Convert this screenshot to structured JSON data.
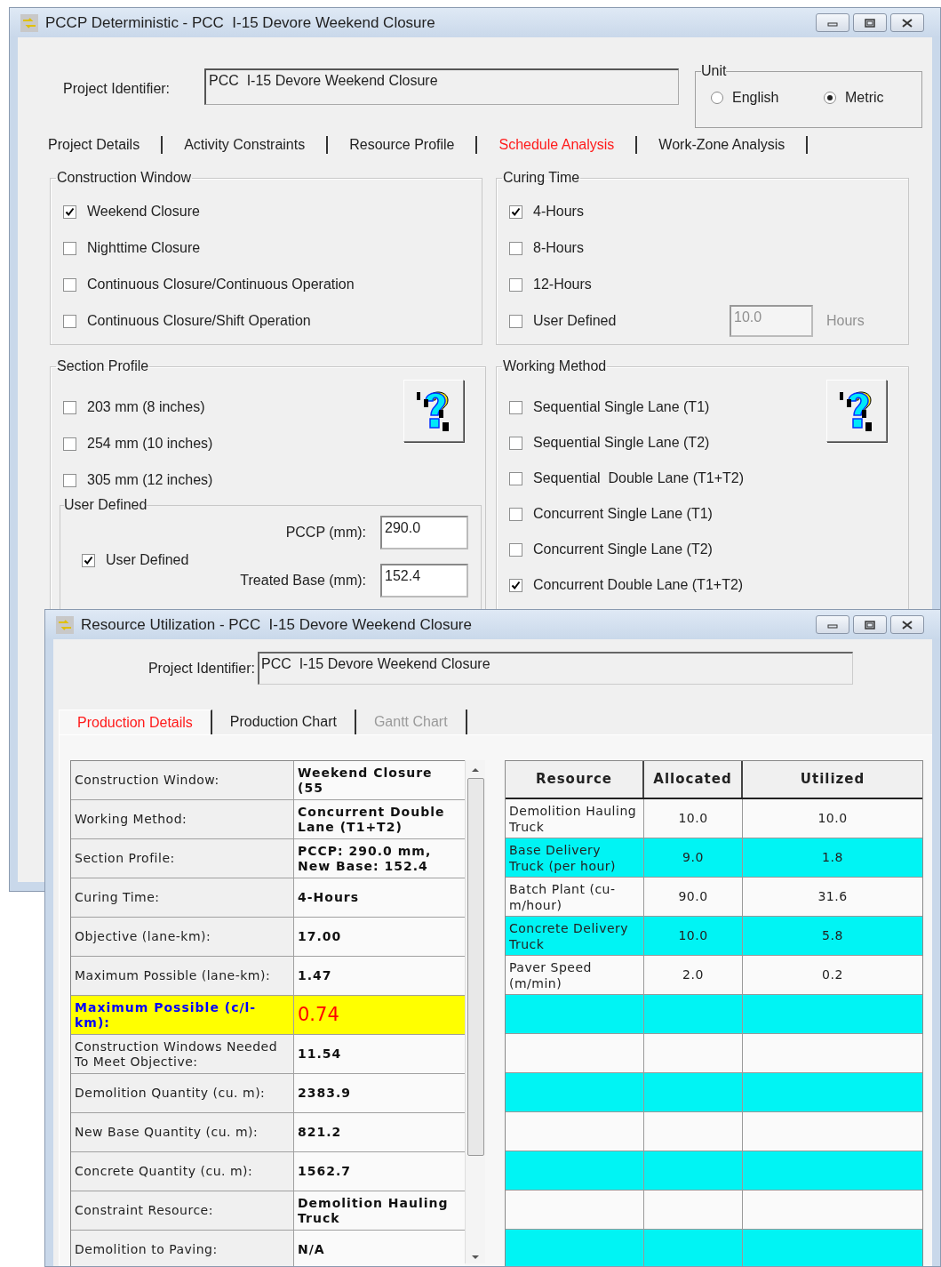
{
  "main_window": {
    "title": "PCCP Deterministic - PCC  I-15 Devore Weekend Closure",
    "project_identifier": {
      "label": "Project Identifier:",
      "value": "PCC  I-15 Devore Weekend Closure"
    },
    "unit": {
      "title": "Unit",
      "options": [
        {
          "label": "English",
          "selected": false
        },
        {
          "label": "Metric",
          "selected": true
        }
      ]
    },
    "tabs": [
      {
        "label": "Project Details",
        "selected": false
      },
      {
        "label": "Activity Constraints",
        "selected": false
      },
      {
        "label": "Resource Profile",
        "selected": false
      },
      {
        "label": "Schedule Analysis",
        "selected": true
      },
      {
        "label": "Work-Zone Analysis",
        "selected": false
      }
    ],
    "construction_window": {
      "title": "Construction Window",
      "options": [
        {
          "label": "Weekend Closure",
          "checked": true
        },
        {
          "label": "Nighttime Closure",
          "checked": false
        },
        {
          "label": "Continuous Closure/Continuous Operation",
          "checked": false
        },
        {
          "label": "Continuous Closure/Shift Operation",
          "checked": false
        }
      ]
    },
    "curing_time": {
      "title": "Curing Time",
      "options": [
        {
          "label": "4-Hours",
          "checked": true
        },
        {
          "label": "8-Hours",
          "checked": false
        },
        {
          "label": "12-Hours",
          "checked": false
        },
        {
          "label": "User Defined",
          "checked": false
        }
      ],
      "user_hours": {
        "value": "10.0",
        "unit": "Hours",
        "disabled": true
      }
    },
    "section_profile": {
      "title": "Section Profile",
      "options": [
        {
          "label": "203 mm (8 inches)",
          "checked": false
        },
        {
          "label": "254 mm (10 inches)",
          "checked": false
        },
        {
          "label": "305 mm (12 inches)",
          "checked": false
        }
      ],
      "user_defined": {
        "title": "User Defined",
        "checkbox": {
          "label": "User Defined",
          "checked": true
        },
        "fields": [
          {
            "label": "PCCP (mm):",
            "value": "290.0"
          },
          {
            "label": "Treated Base (mm):",
            "value": "152.4"
          }
        ]
      }
    },
    "working_method": {
      "title": "Working Method",
      "options": [
        {
          "label": "Sequential Single Lane (T1)",
          "checked": false
        },
        {
          "label": "Sequential Single Lane (T2)",
          "checked": false
        },
        {
          "label": "Sequential  Double Lane (T1+T2)",
          "checked": false
        },
        {
          "label": "Concurrent Single Lane (T1)",
          "checked": false
        },
        {
          "label": "Concurrent Single Lane (T2)",
          "checked": false
        },
        {
          "label": "Concurrent Double Lane (T1+T2)",
          "checked": true
        }
      ]
    }
  },
  "resource_window": {
    "title": "Resource Utilization - PCC  I-15 Devore Weekend Closure",
    "project_identifier": {
      "label": "Project Identifier:",
      "value": "PCC  I-15 Devore Weekend Closure"
    },
    "tabs": [
      {
        "label": "Production Details",
        "selected": true,
        "disabled": false
      },
      {
        "label": "Production Chart",
        "selected": false,
        "disabled": false
      },
      {
        "label": "Gantt Chart",
        "selected": false,
        "disabled": true
      }
    ],
    "details": [
      {
        "label": "Construction Window:",
        "value": "Weekend Closure (55",
        "highlighted": false
      },
      {
        "label": "Working Method:",
        "value": "Concurrent Double Lane (T1+T2)",
        "highlighted": false
      },
      {
        "label": "Section Profile:",
        "value": "PCCP: 290.0 mm, New Base: 152.4",
        "highlighted": false
      },
      {
        "label": "Curing Time:",
        "value": "4-Hours",
        "highlighted": false
      },
      {
        "label": "Objective (lane-km):",
        "value": "17.00",
        "highlighted": false
      },
      {
        "label": "Maximum Possible (lane-km):",
        "value": "1.47",
        "highlighted": false
      },
      {
        "label": "Maximum Possible (c/l-km):",
        "value": "0.74",
        "highlighted": true
      },
      {
        "label": "Construction Windows Needed To Meet Objective:",
        "value": "11.54",
        "highlighted": false
      },
      {
        "label": "Demolition Quantity (cu. m):",
        "value": "2383.9",
        "highlighted": false
      },
      {
        "label": "New Base Quantity (cu. m):",
        "value": "821.2",
        "highlighted": false
      },
      {
        "label": "Concrete Quantity (cu. m):",
        "value": "1562.7",
        "highlighted": false
      },
      {
        "label": "Constraint Resource:",
        "value": "Demolition Hauling Truck",
        "highlighted": false
      },
      {
        "label": "Demolition to Paving:",
        "value": "N/A",
        "highlighted": false
      }
    ],
    "resource_table": {
      "columns": [
        "Resource",
        "Allocated",
        "Utilized"
      ],
      "rows": [
        {
          "resource": "Demolition Hauling Truck",
          "allocated": "10.0",
          "utilized": "10.0",
          "highlighted": false
        },
        {
          "resource": "Base Delivery Truck (per hour)",
          "allocated": "9.0",
          "utilized": "1.8",
          "highlighted": true
        },
        {
          "resource": "Batch Plant (cu-m/hour)",
          "allocated": "90.0",
          "utilized": "31.6",
          "highlighted": false
        },
        {
          "resource": "Concrete Delivery Truck",
          "allocated": "10.0",
          "utilized": "5.8",
          "highlighted": true
        },
        {
          "resource": "Paver Speed (m/min)",
          "allocated": "2.0",
          "utilized": "0.2",
          "highlighted": false
        },
        {
          "highlighted": true
        },
        {
          "highlighted": false
        },
        {
          "highlighted": true
        },
        {
          "highlighted": false
        },
        {
          "highlighted": true
        },
        {
          "highlighted": false
        },
        {
          "highlighted": true
        }
      ]
    }
  }
}
